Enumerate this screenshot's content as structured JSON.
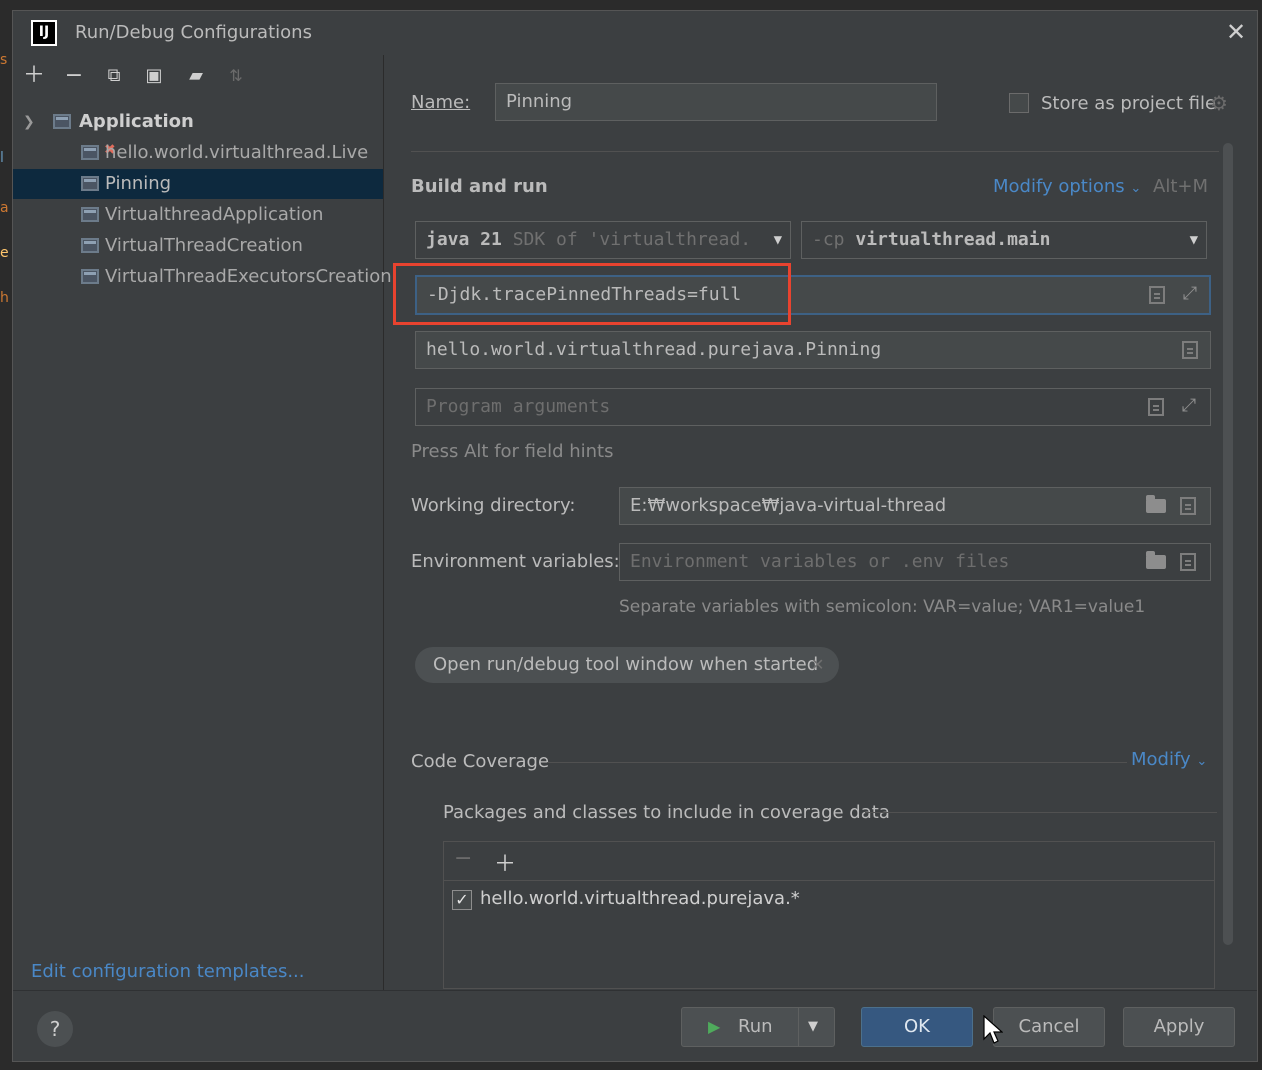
{
  "dialog": {
    "title": "Run/Debug Configurations",
    "app_icon_text": "IJ"
  },
  "left": {
    "toolbar": [
      "add",
      "remove",
      "copy",
      "save",
      "move-to-folder",
      "sort"
    ],
    "tree": {
      "group_label": "Application",
      "items": [
        {
          "label": "hello.world.virtualthread.Live",
          "error": true
        },
        {
          "label": "Pinning",
          "selected": true
        },
        {
          "label": "VirtualthreadApplication"
        },
        {
          "label": "VirtualThreadCreation"
        },
        {
          "label": "VirtualThreadExecutorsCreation"
        }
      ]
    },
    "edit_templates": "Edit configuration templates..."
  },
  "form": {
    "name_label": "Name:",
    "name_value": "Pinning",
    "store_label": "Store as project file",
    "build_run_label": "Build and run",
    "modify_options": "Modify options",
    "modify_shortcut": "Alt+M",
    "jdk_bold": "java 21",
    "jdk_dim": "SDK of 'virtualthread.",
    "cp_dim": "-cp",
    "cp_value": "virtualthread.main",
    "vm_options": "-Djdk.tracePinnedThreads=full",
    "main_class": "hello.world.virtualthread.purejava.Pinning",
    "program_args_placeholder": "Program arguments",
    "hint": "Press Alt for field hints",
    "workdir_label": "Working directory:",
    "workdir_value": "E:₩workspace₩java-virtual-thread",
    "env_label": "Environment variables:",
    "env_placeholder": "Environment variables or .env files",
    "env_hint": "Separate variables with semicolon: VAR=value; VAR1=value1",
    "chip_label": "Open run/debug tool window when started"
  },
  "coverage": {
    "title": "Code Coverage",
    "modify": "Modify",
    "packages_label": "Packages and classes to include in coverage data",
    "entries": [
      {
        "label": "hello.world.virtualthread.purejava.*",
        "checked": true
      }
    ]
  },
  "buttons": {
    "help": "?",
    "run": "Run",
    "ok": "OK",
    "cancel": "Cancel",
    "apply": "Apply"
  },
  "colors": {
    "accent": "#4a88c7",
    "highlight": "#e8432f",
    "ok": "#365880",
    "selection": "#0d293e"
  }
}
